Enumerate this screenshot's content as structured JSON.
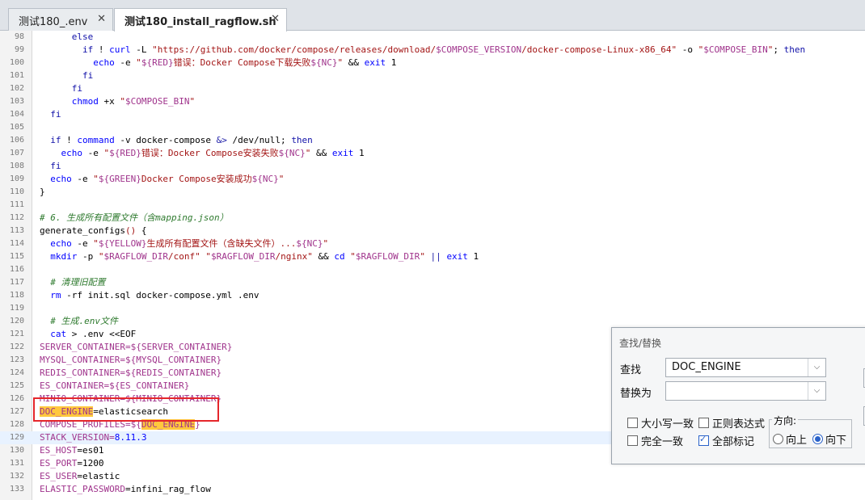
{
  "tabs": [
    {
      "label": "测试180_.env",
      "close": "✕"
    },
    {
      "label": "测试180_install_ragflow.sh",
      "close": "✕"
    }
  ],
  "lines": {
    "98": {
      "n": "98",
      "a": "      ",
      "b": "else"
    },
    "99": {
      "n": "99",
      "a": "        ",
      "b": "if",
      "c": " ! ",
      "d": "curl",
      "e": " -L ",
      "f": "\"https://github.com/docker/compose/releases/download/",
      "g": "$COMPOSE_VERSION",
      "h": "/docker-compose-Linux-x86_64\"",
      "i": " -o ",
      "j": "\"",
      "k": "$COMPOSE_BIN",
      "l": "\"",
      "m": "; ",
      "o": "then"
    },
    "100": {
      "n": "100",
      "a": "          ",
      "b": "echo",
      "c": " -e ",
      "d": "\"",
      "e": "${RED}",
      "f": "错误：Docker Compose下载失败",
      "g": "${NC}",
      "h": "\"",
      "i": " && ",
      "j": "exit",
      "k": " 1"
    },
    "101": {
      "n": "101",
      "a": "        ",
      "b": "fi"
    },
    "102": {
      "n": "102",
      "a": "      ",
      "b": "fi"
    },
    "103": {
      "n": "103",
      "a": "      ",
      "b": "chmod",
      "c": " +x ",
      "d": "\"",
      "e": "$COMPOSE_BIN",
      "f": "\""
    },
    "104": {
      "n": "104",
      "a": "  ",
      "b": "fi"
    },
    "105": {
      "n": "105",
      "a": ""
    },
    "106": {
      "n": "106",
      "a": "  ",
      "b": "if",
      "c": " ! ",
      "d": "command",
      "e": " -v docker-compose ",
      "f": "&>",
      "g": " /dev/null; ",
      "h": "then"
    },
    "107": {
      "n": "107",
      "a": "    ",
      "b": "echo",
      "c": " -e ",
      "d": "\"",
      "e": "${RED}",
      "f": "错误：Docker Compose安装失败",
      "g": "${NC}",
      "h": "\"",
      "i": " && ",
      "j": "exit",
      "k": " 1"
    },
    "108": {
      "n": "108",
      "a": "  ",
      "b": "fi"
    },
    "109": {
      "n": "109",
      "a": "  ",
      "b": "echo",
      "c": " -e ",
      "d": "\"",
      "e": "${GREEN}",
      "f": "Docker Compose安装成功",
      "g": "${NC}",
      "h": "\""
    },
    "110": {
      "n": "110",
      "a": "}"
    },
    "111": {
      "n": "111",
      "a": ""
    },
    "112": {
      "n": "112",
      "a": "# 6. 生成所有配置文件（含mapping.json）"
    },
    "113": {
      "n": "113",
      "a": "generate_configs",
      "b": "()",
      "c": " {"
    },
    "114": {
      "n": "114",
      "a": "  ",
      "b": "echo",
      "c": " -e ",
      "d": "\"",
      "e": "${YELLOW}",
      "f": "生成所有配置文件（含缺失文件）...",
      "g": "${NC}",
      "h": "\""
    },
    "115": {
      "n": "115",
      "a": "  ",
      "b": "mkdir",
      "c": " -p ",
      "d": "\"",
      "e": "$RAGFLOW_DIR",
      "f": "/conf\"",
      "g": " ",
      "h": "\"",
      "i": "$RAGFLOW_DIR",
      "j": "/nginx\"",
      "k": " && ",
      "l": "cd",
      "m": " ",
      "o": "\"",
      "p": "$RAGFLOW_DIR",
      "q": "\"",
      "r": " || ",
      "s": "exit",
      "t": " 1"
    },
    "116": {
      "n": "116",
      "a": ""
    },
    "117": {
      "n": "117",
      "a": "  ",
      "b": "# 清理旧配置"
    },
    "118": {
      "n": "118",
      "a": "  ",
      "b": "rm",
      "c": " -rf init.sql docker-compose.yml .env"
    },
    "119": {
      "n": "119",
      "a": ""
    },
    "120": {
      "n": "120",
      "a": "  ",
      "b": "# 生成.env文件"
    },
    "121": {
      "n": "121",
      "a": "  ",
      "b": "cat",
      "c": " > .env <<EOF"
    },
    "122": {
      "n": "122",
      "a": "SERVER_CONTAINER=${SERVER_CONTAINER}"
    },
    "123": {
      "n": "123",
      "a": "MYSQL_CONTAINER=${MYSQL_CONTAINER}"
    },
    "124": {
      "n": "124",
      "a": "REDIS_CONTAINER=${REDIS_CONTAINER}"
    },
    "125": {
      "n": "125",
      "a": "ES_CONTAINER=${ES_CONTAINER}"
    },
    "126": {
      "n": "126",
      "a": "MINIO_CONTAINER=${MINIO_CONTAINER}"
    },
    "127": {
      "n": "127",
      "a": "DOC_ENGINE",
      "b": "=elasticsearch"
    },
    "128": {
      "n": "128",
      "a": "COMPOSE_PROFILES=${",
      "b": "DOC_ENGINE",
      "c": "}"
    },
    "129": {
      "n": "129",
      "a": "STACK_VERSION=",
      "b": "8.11.3"
    },
    "130": {
      "n": "130",
      "a": "ES_HOST",
      "b": "=es01"
    },
    "131": {
      "n": "131",
      "a": "ES_PORT",
      "b": "=1200"
    },
    "132": {
      "n": "132",
      "a": "ES_USER",
      "b": "=elastic"
    },
    "133": {
      "n": "133",
      "a": "ELASTIC_PASSWORD",
      "b": "=infini_rag_flow"
    }
  },
  "find_dialog": {
    "title": "查找/替换",
    "find_label": "查找",
    "find_value": "DOC_ENGINE",
    "replace_label": "替换为",
    "replace_value": "",
    "match_case": "大小写一致",
    "regex": "正则表达式",
    "whole_word": "完全一致",
    "mark_all": "全部标记",
    "direction_label": "方向:",
    "up": "向上",
    "down": "向下",
    "arrow": "⌵"
  }
}
